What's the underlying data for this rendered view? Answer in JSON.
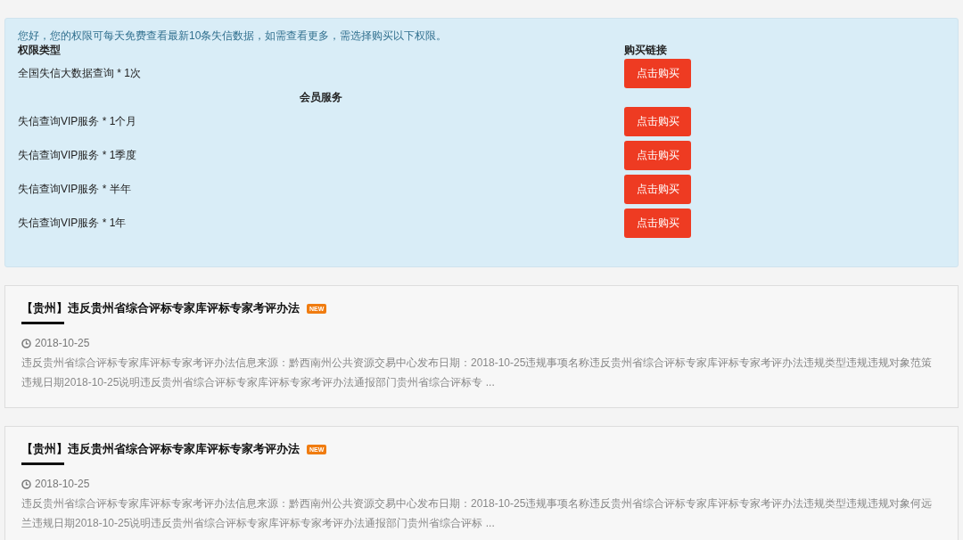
{
  "notice": {
    "message": "您好，您的权限可每天免费查看最新10条失信数据，如需查看更多，需选择购买以下权限。",
    "columns": [
      "权限类型",
      "购买链接"
    ],
    "rows": [
      {
        "kind": "item",
        "label": "全国失信大数据查询 * 1次",
        "button": "点击购买"
      },
      {
        "kind": "section",
        "label": "会员服务"
      },
      {
        "kind": "item",
        "label": "失信查询VIP服务 * 1个月",
        "button": "点击购买"
      },
      {
        "kind": "item",
        "label": "失信查询VIP服务 * 1季度",
        "button": "点击购买"
      },
      {
        "kind": "item",
        "label": "失信查询VIP服务 * 半年",
        "button": "点击购买"
      },
      {
        "kind": "item",
        "label": "失信查询VIP服务 * 1年",
        "button": "点击购买"
      }
    ]
  },
  "articles": [
    {
      "title": "【贵州】违反贵州省综合评标专家库评标专家考评办法",
      "badge": "NEW",
      "date": "2018-10-25",
      "summary": "违反贵州省综合评标专家库评标专家考评办法信息来源：黔西南州公共资源交易中心发布日期：2018-10-25违规事项名称违反贵州省综合评标专家库评标专家考评办法违规类型违规违规对象范策违规日期2018-10-25说明违反贵州省综合评标专家库评标专家考评办法通报部门贵州省综合评标专 ..."
    },
    {
      "title": "【贵州】违反贵州省综合评标专家库评标专家考评办法",
      "badge": "NEW",
      "date": "2018-10-25",
      "summary": "违反贵州省综合评标专家库评标专家考评办法信息来源：黔西南州公共资源交易中心发布日期：2018-10-25违规事项名称违反贵州省综合评标专家库评标专家考评办法违规类型违规违规对象何远兰违规日期2018-10-25说明违反贵州省综合评标专家库评标专家考评办法通报部门贵州省综合评标 ..."
    }
  ]
}
